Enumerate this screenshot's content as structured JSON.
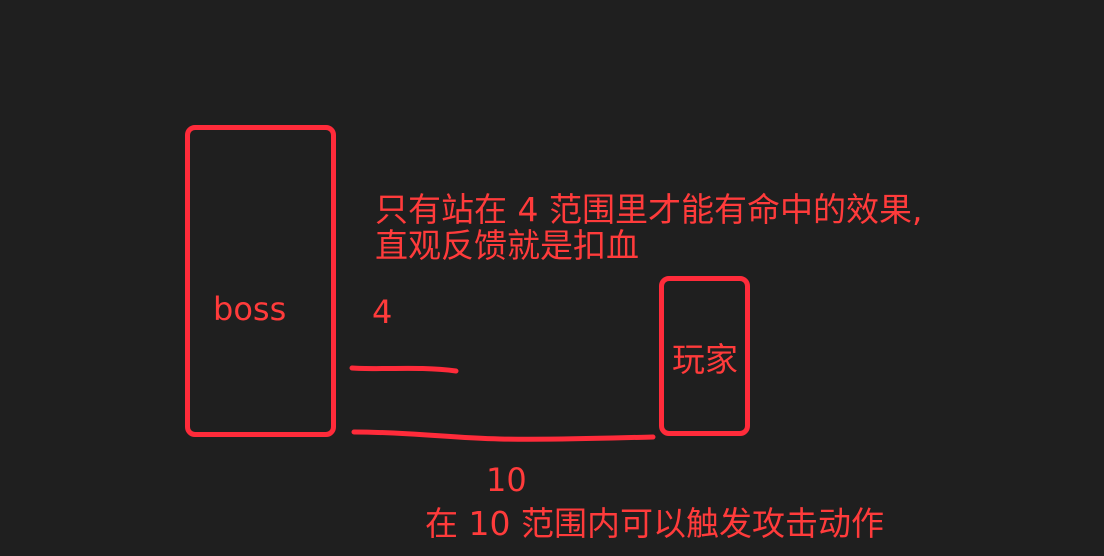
{
  "colors": {
    "background": "#1f1f1f",
    "stroke": "#ff2b3a",
    "text": "#ff3b3b"
  },
  "diagram": {
    "boss_label": "boss",
    "player_label": "玩家",
    "range4_label": "4",
    "range10_label": "10",
    "note_top_line1": "只有站在 4 范围里才能有命中的效果,",
    "note_top_line2": "直观反馈就是扣血",
    "note_bottom": "在 10 范围内可以触发攻击动作"
  }
}
